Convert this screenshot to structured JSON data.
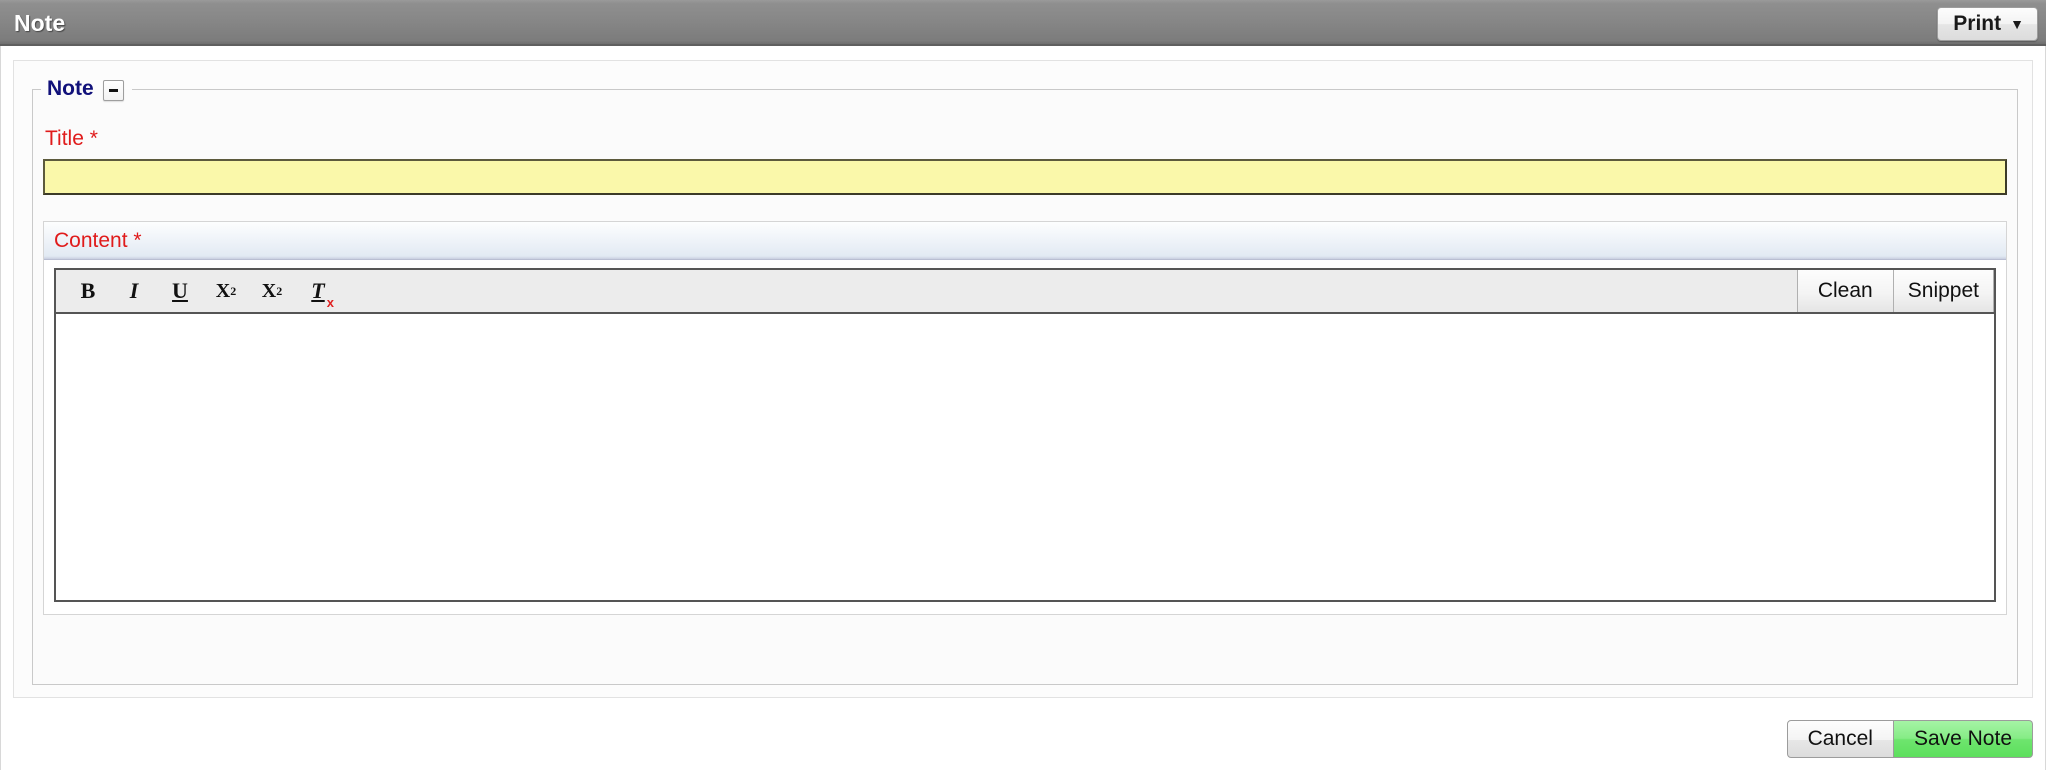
{
  "titlebar": {
    "title": "Note",
    "print_label": "Print",
    "print_caret": "▼"
  },
  "fieldset": {
    "legend": "Note",
    "toggle_icon": "minus-icon"
  },
  "form": {
    "title_field": {
      "label": "Title",
      "required_mark": "*",
      "value": "",
      "placeholder": ""
    },
    "content_field": {
      "label": "Content",
      "required_mark": "*",
      "value": "",
      "placeholder": ""
    }
  },
  "editor_toolbar": {
    "tools": [
      {
        "name": "bold-icon",
        "glyph": "B",
        "title": "Bold"
      },
      {
        "name": "italic-icon",
        "glyph": "I",
        "title": "Italic"
      },
      {
        "name": "underline-icon",
        "glyph": "U",
        "title": "Underline"
      },
      {
        "name": "subscript-icon",
        "glyph": "X",
        "sub": "2",
        "title": "Subscript"
      },
      {
        "name": "superscript-icon",
        "glyph": "X",
        "sup": "2",
        "title": "Superscript"
      },
      {
        "name": "remove-format-icon",
        "glyph": "T",
        "sub": "x",
        "title": "Remove Format"
      }
    ],
    "clean_label": "Clean",
    "snippet_label": "Snippet"
  },
  "footer": {
    "cancel_label": "Cancel",
    "save_label": "Save Note"
  },
  "colors": {
    "titlebar_gray": "#868686",
    "legend_blue": "#11117a",
    "required_red": "#e01b1b",
    "input_yellow": "#faf8aa",
    "save_green": "#6ee56e"
  }
}
